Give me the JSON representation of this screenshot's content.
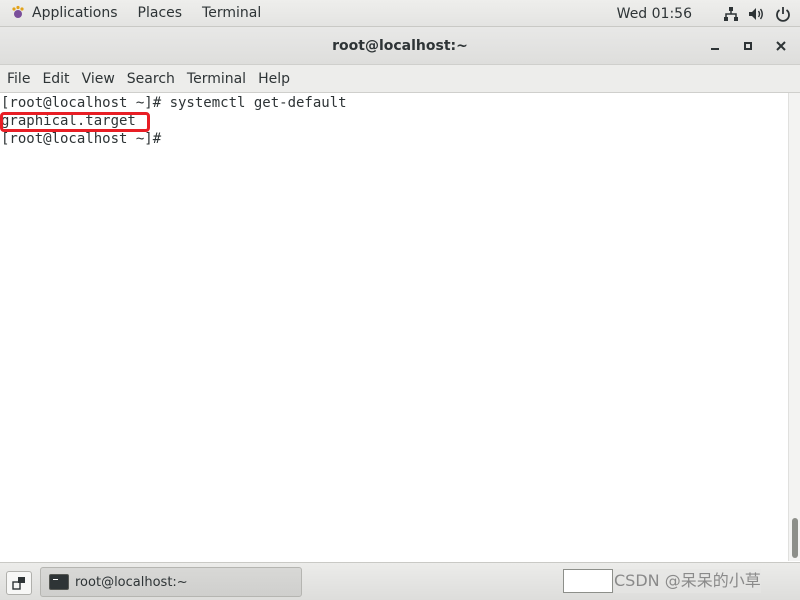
{
  "top_panel": {
    "applications": "Applications",
    "places": "Places",
    "terminal": "Terminal",
    "clock": "Wed 01:56",
    "icons": [
      "network-icon",
      "volume-icon",
      "power-icon"
    ]
  },
  "window": {
    "title": "root@localhost:~"
  },
  "menubar": {
    "items": [
      "File",
      "Edit",
      "View",
      "Search",
      "Terminal",
      "Help"
    ]
  },
  "terminal": {
    "lines": [
      "[root@localhost ~]# systemctl get-default",
      "graphical.target",
      "[root@localhost ~]#"
    ],
    "highlight_color": "#e81e25"
  },
  "taskbar": {
    "task_label": "root@localhost:~",
    "watermark": "CSDN @呆呆的小草"
  }
}
